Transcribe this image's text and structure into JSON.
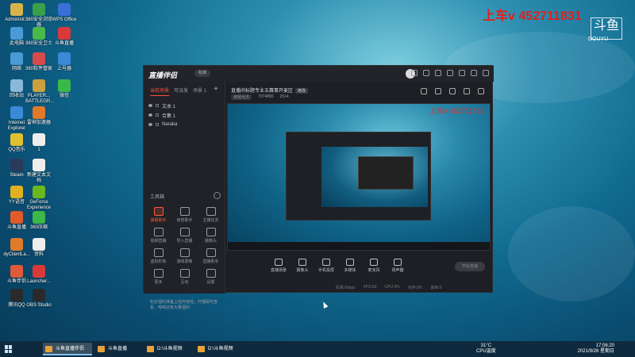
{
  "watermark": "上车v 452711831",
  "watermark_small": "上车v 452711831",
  "corner_logo": "斗鱼",
  "corner_logo_sub": "DOUYU",
  "desktop_icons": [
    {
      "label": "Administr...",
      "color": "#d8b24a"
    },
    {
      "label": "360安全浏览器",
      "color": "#3aa04a"
    },
    {
      "label": "WPS Office",
      "color": "#3a6fd8"
    },
    {
      "label": "此电脑",
      "color": "#4a9ad8"
    },
    {
      "label": "360安全卫士",
      "color": "#4ab84a"
    },
    {
      "label": "斗鱼直播",
      "color": "#d83a3a"
    },
    {
      "label": "网络",
      "color": "#4a9ad8"
    },
    {
      "label": "360软件管家",
      "color": "#d84a4a"
    },
    {
      "label": "上号器",
      "color": "#3a8ad8"
    },
    {
      "label": "回收站",
      "color": "#8ab8d8"
    },
    {
      "label": "PLAYER... BATTLEGR...",
      "color": "#caa040"
    },
    {
      "label": "微信",
      "color": "#3ab84a"
    },
    {
      "label": "Internet Explorer",
      "color": "#3a8ad8"
    },
    {
      "label": "雷神加速器",
      "color": "#e07a2a"
    },
    {
      "label": "QQ音乐",
      "color": "#e0c030"
    },
    {
      "label": "1",
      "color": "#eeeeee"
    },
    {
      "label": "Steam",
      "color": "#2a3a5a"
    },
    {
      "label": "新建文本文档",
      "color": "#eeeeee"
    },
    {
      "label": "YY语音",
      "color": "#e0b020"
    },
    {
      "label": "GeForce Experience",
      "color": "#6ab820"
    },
    {
      "label": "斗鱼直播",
      "color": "#e05a2a"
    },
    {
      "label": "360压缩",
      "color": "#3ab84a"
    },
    {
      "label": "dyClientLa...",
      "color": "#e07a2a"
    },
    {
      "label": "资料",
      "color": "#eeeeee"
    },
    {
      "label": "斗鱼伴侣",
      "color": "#e05a3a"
    },
    {
      "label": "Launcher...",
      "color": "#d83a3a"
    },
    {
      "label": "腾讯QQ",
      "color": "#2a2a2a"
    },
    {
      "label": "OBS Studio",
      "color": "#2a2a2a"
    }
  ],
  "app": {
    "brand": "直播伴侣",
    "version": "标准",
    "left_tabs": [
      "当前场景",
      "可派发",
      "场景 1"
    ],
    "sources": [
      "文本 1",
      "合集 1",
      "Naraka"
    ],
    "tools_title": "工具箱",
    "tools": [
      {
        "label": "弹幕助手",
        "hot": true
      },
      {
        "label": "房管助手",
        "hot": false
      },
      {
        "label": "主播任务",
        "hot": false
      },
      {
        "label": "视频直播",
        "hot": false
      },
      {
        "label": "导入直播",
        "hot": false
      },
      {
        "label": "摄像头",
        "hot": false
      },
      {
        "label": "虚拟形象",
        "hot": false
      },
      {
        "label": "游戏录像",
        "hot": false
      },
      {
        "label": "直播助手",
        "hot": false
      },
      {
        "label": "更多",
        "hot": false
      },
      {
        "label": "互动",
        "hot": false
      },
      {
        "label": "设置",
        "hot": false
      }
    ],
    "notice": "粉丝福利准备上线开放啦，开播即可查看，喝喝还有大量福利",
    "room_title": "直播间标题专业五赛事开麦区",
    "title_tag": "修改",
    "sub_chip": "未经允许",
    "viewers": "7074880",
    "hot": "2514",
    "controls": [
      "直播场景",
      "摄像头",
      "手机投屏",
      "多媒体",
      "麦克风",
      "扬声器"
    ],
    "start_button": "开始直播",
    "stats": [
      "码率:0kbps",
      "FPS:60",
      "CPU:3%",
      "内存:0%",
      "丢帧:0"
    ]
  },
  "taskbar": {
    "items": [
      "斗鱼直播伴侣",
      "斗鱼直播",
      "D:\\斗鱼视频",
      "D:\\斗鱼视频"
    ],
    "weather_temp": "31°C",
    "weather_text": "CPU温度",
    "time": "17:06:20",
    "date": "2021/9/26 星期日"
  }
}
